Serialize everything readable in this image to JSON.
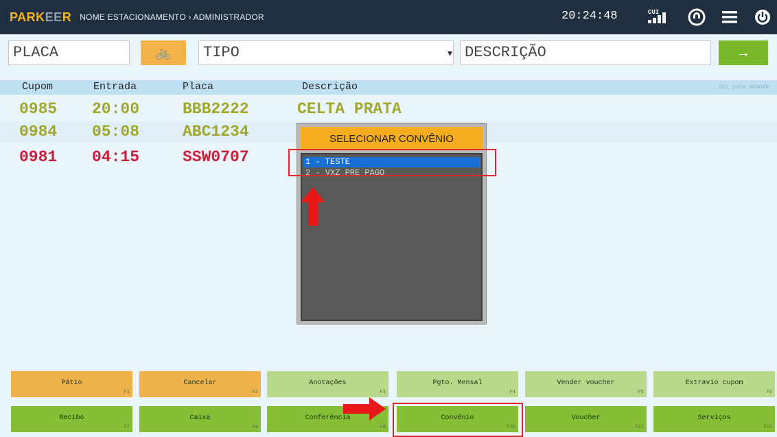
{
  "header": {
    "logo_main": "PARK",
    "logo_ee": "EE",
    "logo_end": "R",
    "breadcrumb": "NOME ESTACIONAMENTO › ADMINISTRADOR",
    "clock": "20:24:48",
    "signal_label": "CUI"
  },
  "inputs": {
    "placa_placeholder": "PLACA",
    "bike_icon": "🚲",
    "tipo_placeholder": "TIPO",
    "descricao_placeholder": "DESCRIÇÃO",
    "go_label": "→"
  },
  "table": {
    "headers": [
      "Cupom",
      "Entrada",
      "Placa",
      "Descrição"
    ],
    "hint": "DEL para APAGAR",
    "rows": [
      {
        "cupom": "0985",
        "entrada": "20:00",
        "placa": "BBB2222",
        "descricao": "CELTA PRATA",
        "color": "#a0a829"
      },
      {
        "cupom": "0984",
        "entrada": "05:08",
        "placa": "ABC1234",
        "descricao": "",
        "color": "#a0a829"
      },
      {
        "cupom": "0981",
        "entrada": "04:15",
        "placa": "SSW0707",
        "descricao": "",
        "color": "#c8203a"
      }
    ]
  },
  "dialog": {
    "title": "SELECIONAR CONVÊNIO",
    "options": [
      "1 - TESTE",
      "2 - VXZ PRE PAGO"
    ],
    "selected_index": 0
  },
  "function_keys": [
    {
      "label": "Pátio",
      "key": "F1",
      "style": "orange"
    },
    {
      "label": "Cancelar",
      "key": "F2",
      "style": "orange"
    },
    {
      "label": "Anotações",
      "key": "F3",
      "style": "lgreen"
    },
    {
      "label": "Pgto. Mensal",
      "key": "F4",
      "style": "lgreen"
    },
    {
      "label": "Vender voucher",
      "key": "F5",
      "style": "lgreen"
    },
    {
      "label": "Extravio cupom",
      "key": "F6",
      "style": "lgreen"
    },
    {
      "label": "Recibo",
      "key": "F7",
      "style": "dgreen"
    },
    {
      "label": "Caixa",
      "key": "F8",
      "style": "dgreen"
    },
    {
      "label": "Conferência",
      "key": "F9",
      "style": "dgreen"
    },
    {
      "label": "Convênio",
      "key": "F10",
      "style": "dgreen"
    },
    {
      "label": "Voucher",
      "key": "F11",
      "style": "dgreen"
    },
    {
      "label": "Serviços",
      "key": "F12",
      "style": "dgreen"
    }
  ],
  "colors": {
    "accent_orange": "#f5ad1f",
    "accent_green": "#86bf36",
    "highlight_red": "#e02828"
  }
}
